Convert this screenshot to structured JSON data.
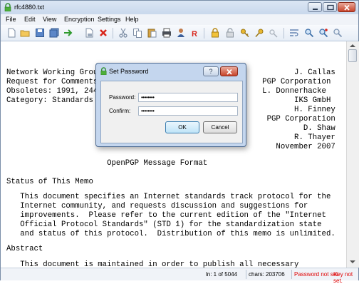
{
  "window": {
    "title": "rfc4880.txt"
  },
  "menu": [
    "File",
    "Edit",
    "View",
    "Encryption",
    "Settings",
    "Help"
  ],
  "toolbar_icons": [
    "new-file-icon",
    "open-folder-icon",
    "save-icon",
    "save-all-icon",
    "export-icon",
    "close-doc-icon",
    "delete-icon",
    "cut-icon",
    "copy-icon",
    "paste-icon",
    "print-icon",
    "user-icon",
    "reset-icon",
    "lock-icon",
    "unlock-icon",
    "key-icon",
    "key-manage-icon",
    "key-disabled-icon",
    "word-wrap-icon",
    "find-icon",
    "find-next-icon",
    "zoom-icon"
  ],
  "document_lines": [
    "",
    "Network Working Group                                          J. Callas",
    "Request for Comments: 4880                              PGP Corporation",
    "Obsoletes: 1991, 2440                                   L. Donnerhacke",
    "Category: Standards Track                                      IKS GmbH",
    "                                                               H. Finney",
    "                                                         PGP Corporation",
    "                                                                 D. Shaw",
    "                                                               R. Thayer",
    "                                                           November 2007",
    "",
    "                      OpenPGP Message Format",
    "",
    "Status of This Memo",
    "",
    "   This document specifies an Internet standards track protocol for the",
    "   Internet community, and requests discussion and suggestions for",
    "   improvements.  Please refer to the current edition of the \"Internet",
    "   Official Protocol Standards\" (STD 1) for the standardization state",
    "   and status of this protocol.  Distribution of this memo is unlimited.",
    "",
    "Abstract",
    "",
    "   This document is maintained in order to publish all necessary"
  ],
  "status": {
    "position": "ln: 1 of 5044",
    "chars": "chars: 203706",
    "password_status": "Password not set.",
    "key_status": "Key not set.",
    "alert_color": "#e00000"
  },
  "dialog": {
    "title": "Set Password",
    "help_label": "?",
    "password_label": "Password:",
    "password_value": "••••••••",
    "confirm_label": "Confirm:",
    "confirm_value": "••••••••",
    "ok_label": "OK",
    "cancel_label": "Cancel"
  }
}
